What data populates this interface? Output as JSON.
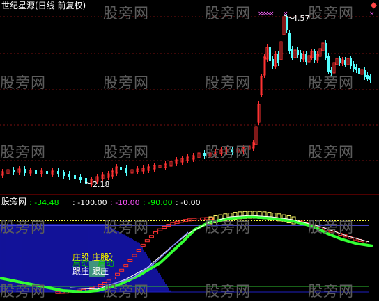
{
  "window": {
    "title": "世纪星源(日线 前复权)",
    "corner_icon": "diamond-icon"
  },
  "watermark": "股旁网",
  "price_panel": {
    "high_label": "4.57",
    "low_label": "2.18",
    "colors": {
      "up": "#ff3232",
      "down": "#54ffff",
      "grid": "#7a1010",
      "marker": "#ff66ff"
    }
  },
  "indicator_panel": {
    "name": "股旁网",
    "readouts": [
      {
        "value": ": -34.48",
        "color": "#00ff00"
      },
      {
        "value": ": -100.00",
        "color": "#ffffff"
      },
      {
        "value": ": -10.00",
        "color": "#ff55ff"
      },
      {
        "value": ": -90.00",
        "color": "#00ff00"
      },
      {
        "value": ": -0.00",
        "color": "#ffffff"
      }
    ],
    "tags": [
      {
        "text": "庄股",
        "color": "#ffff00"
      },
      {
        "text": "庄股",
        "color": "#ffff00"
      },
      {
        "text": "启动",
        "color": "#00cc00"
      },
      {
        "text": "启动",
        "color": "#00cc00"
      },
      {
        "text": "跟庄",
        "color": "#ffffff"
      },
      {
        "text": "跟庄",
        "color": "#ffffff"
      },
      {
        "text": "股",
        "color": "#ffff00"
      }
    ]
  }
}
